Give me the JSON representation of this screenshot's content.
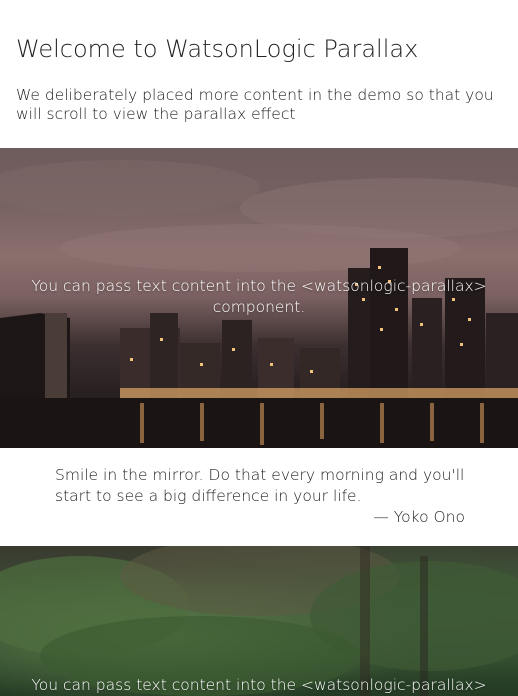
{
  "header": {
    "title": "Welcome to WatsonLogic Parallax",
    "intro": "We deliberately placed more content in the demo so that you will scroll to view the parallax effect"
  },
  "sections": [
    {
      "caption": "You can pass text content into the <watsonlogic-parallax> component.",
      "image": "night-city-skyline"
    },
    {
      "caption": "You can pass text content into the <watsonlogic-parallax>",
      "image": "forest"
    }
  ],
  "quote": {
    "text": "Smile in the mirror. Do that every morning and you'll start to see a big difference in your life.",
    "author": "— Yoko Ono"
  }
}
